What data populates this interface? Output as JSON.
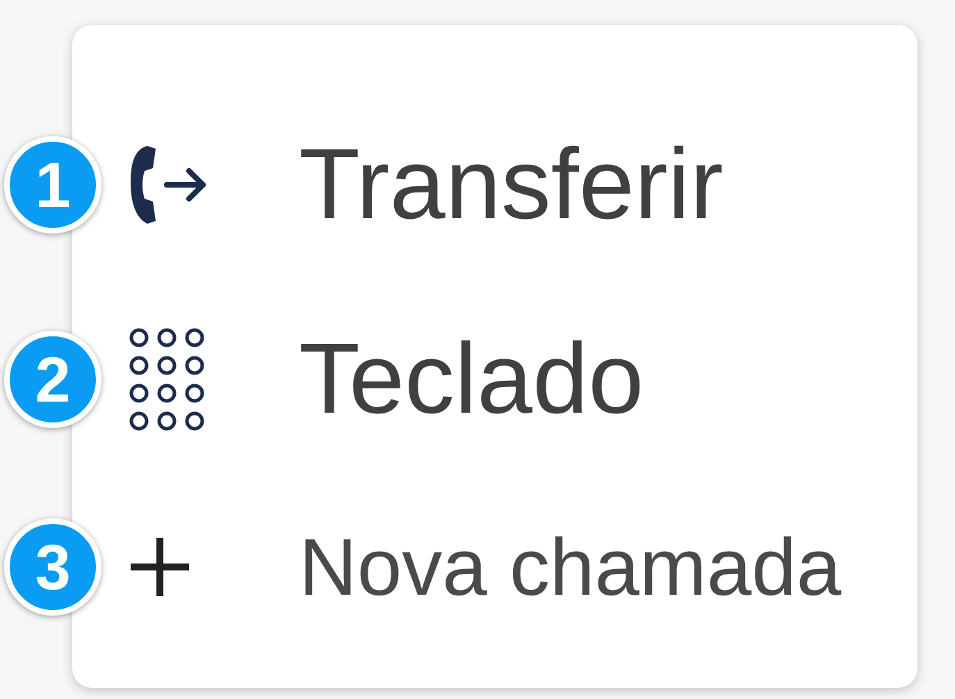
{
  "menu": {
    "items": [
      {
        "kind": "transfer",
        "label": "Transferir",
        "badge": "1"
      },
      {
        "kind": "keypad",
        "label": "Teclado",
        "badge": "2"
      },
      {
        "kind": "new-call",
        "label": "Nova chamada",
        "badge": "3"
      }
    ]
  }
}
